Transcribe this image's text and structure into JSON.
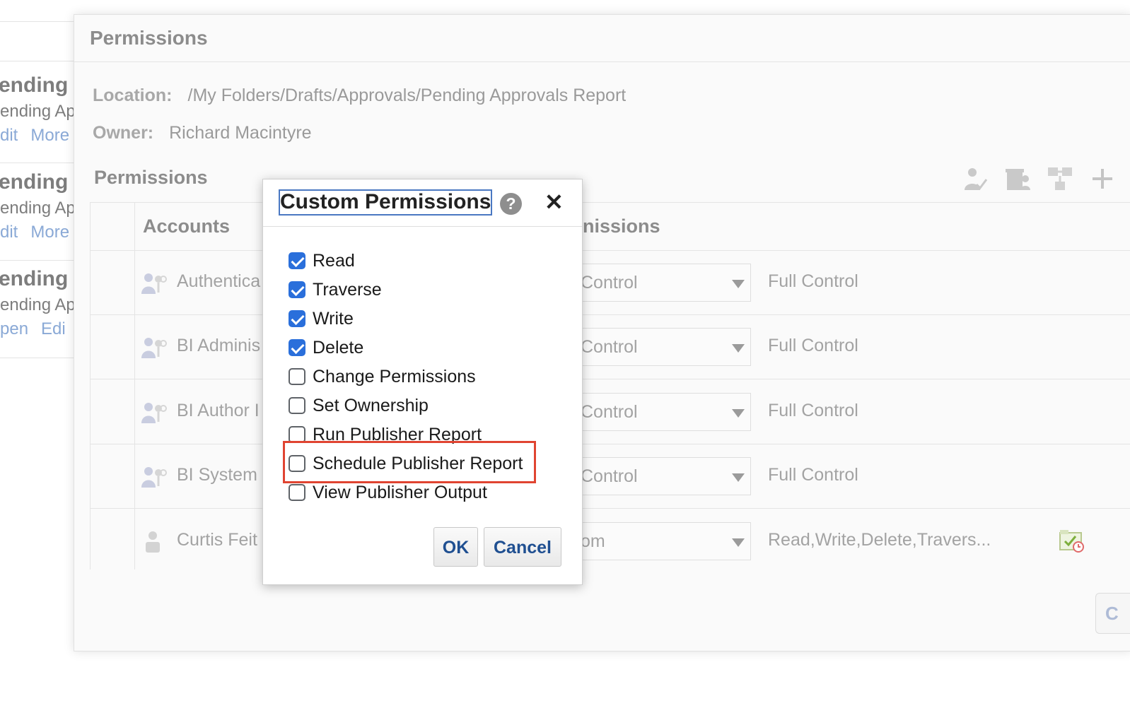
{
  "background_list": {
    "items": [
      {
        "title": "ending",
        "subtitle": "ending Ap",
        "links": [
          "dit",
          "More"
        ]
      },
      {
        "title": "ending",
        "subtitle": "ending Ap",
        "links": [
          "dit",
          "More"
        ]
      },
      {
        "title": "ending",
        "subtitle": "ending Ap",
        "links": [
          "pen",
          "Edi"
        ]
      }
    ]
  },
  "panel": {
    "title": "Permissions",
    "location_label": "Location:",
    "location_value": "/My Folders/Drafts/Approvals/Pending Approvals Report",
    "owner_label": "Owner:",
    "owner_value": "Richard Macintyre",
    "section_title": "Permissions",
    "toolbar_icons": [
      "assign-permission-icon",
      "remove-permission-icon",
      "move-permission-icon",
      "add-icon"
    ]
  },
  "table": {
    "headers": {
      "accounts": "Accounts",
      "permissions": "nissions"
    },
    "rows": [
      {
        "account": "Authentica",
        "icon": "group-icon",
        "selected": "Control",
        "value": "Full Control"
      },
      {
        "account": "BI Adminis",
        "icon": "group-icon",
        "selected": "Control",
        "value": "Full Control"
      },
      {
        "account": "BI Author I",
        "icon": "group-icon",
        "selected": "Control",
        "value": "Full Control"
      },
      {
        "account": "BI System",
        "icon": "group-icon",
        "selected": "Control",
        "value": "Full Control"
      },
      {
        "account": "Curtis Feit",
        "icon": "user-icon",
        "selected": "om",
        "value": "Read,Write,Delete,Travers..."
      }
    ],
    "partial_button": "C"
  },
  "dialog": {
    "title": "Custom Permissions",
    "help": "?",
    "close": "✕",
    "options": [
      {
        "label": "Read",
        "checked": true
      },
      {
        "label": "Traverse",
        "checked": true
      },
      {
        "label": "Write",
        "checked": true
      },
      {
        "label": "Delete",
        "checked": true
      },
      {
        "label": "Change Permissions",
        "checked": false
      },
      {
        "label": "Set Ownership",
        "checked": false
      },
      {
        "label": "Run Publisher Report",
        "checked": false
      },
      {
        "label": "Schedule Publisher Report",
        "checked": false
      },
      {
        "label": "View Publisher Output",
        "checked": false
      }
    ],
    "ok_label": "OK",
    "cancel_label": "Cancel"
  },
  "colors": {
    "accent_blue": "#2a6fdb",
    "highlight_red": "#e04431",
    "link_blue": "#1f4f91"
  }
}
